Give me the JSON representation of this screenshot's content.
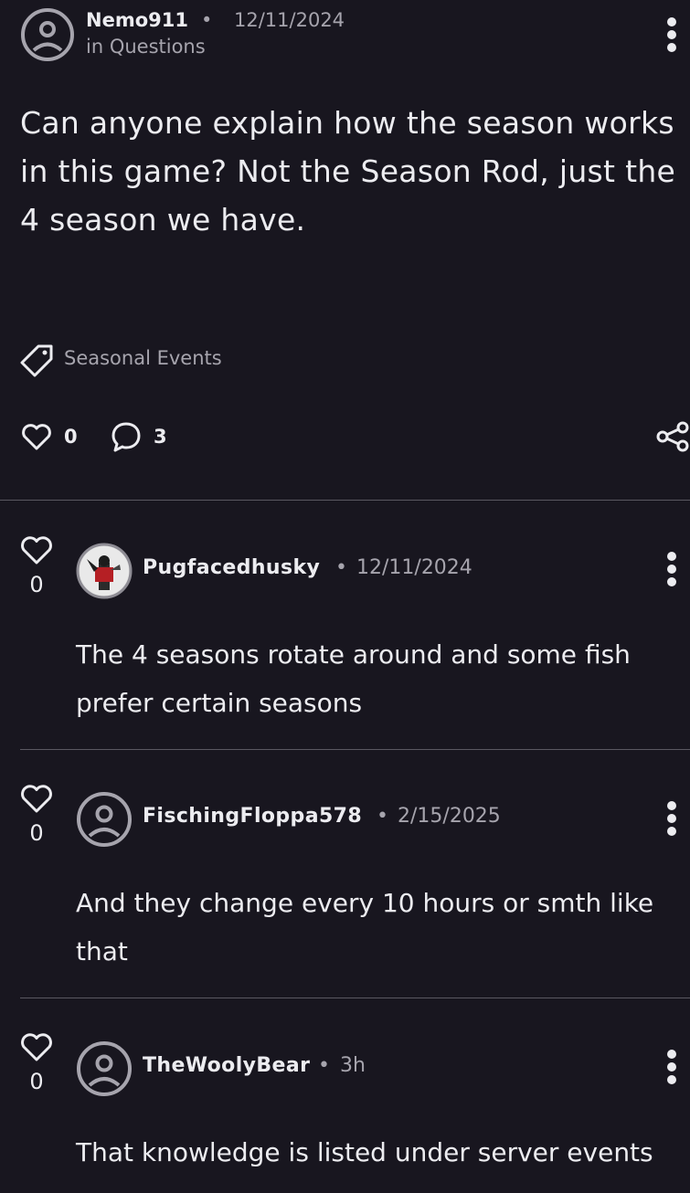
{
  "post": {
    "author": "Nemo911",
    "date": "12/11/2024",
    "category": "in Questions",
    "body": "Can anyone explain how the season works in this game? Not the Season Rod, just the 4 season we have.",
    "tag": "Seasonal Events",
    "likes": "0",
    "comments": "3",
    "separator": "•"
  },
  "replies": [
    {
      "votes": "0",
      "author": "Pugfacedhusky",
      "date": "12/11/2024",
      "text": "The 4 seasons rotate around and some fish prefer certain seasons",
      "avatar": "custom-avatar"
    },
    {
      "votes": "0",
      "author": "FischingFloppa578",
      "date": "2/15/2025",
      "text": "And they change every 10 hours or smth like that",
      "avatar": "default-user-icon"
    },
    {
      "votes": "0",
      "author": "TheWoolyBear",
      "date": "3h",
      "text": "That knowledge is listed under server events",
      "avatar": "default-user-icon"
    }
  ],
  "colors": {
    "background": "#18161f",
    "text": "#ececf0",
    "muted": "#a6a4ad",
    "divider": "#5a5861"
  }
}
